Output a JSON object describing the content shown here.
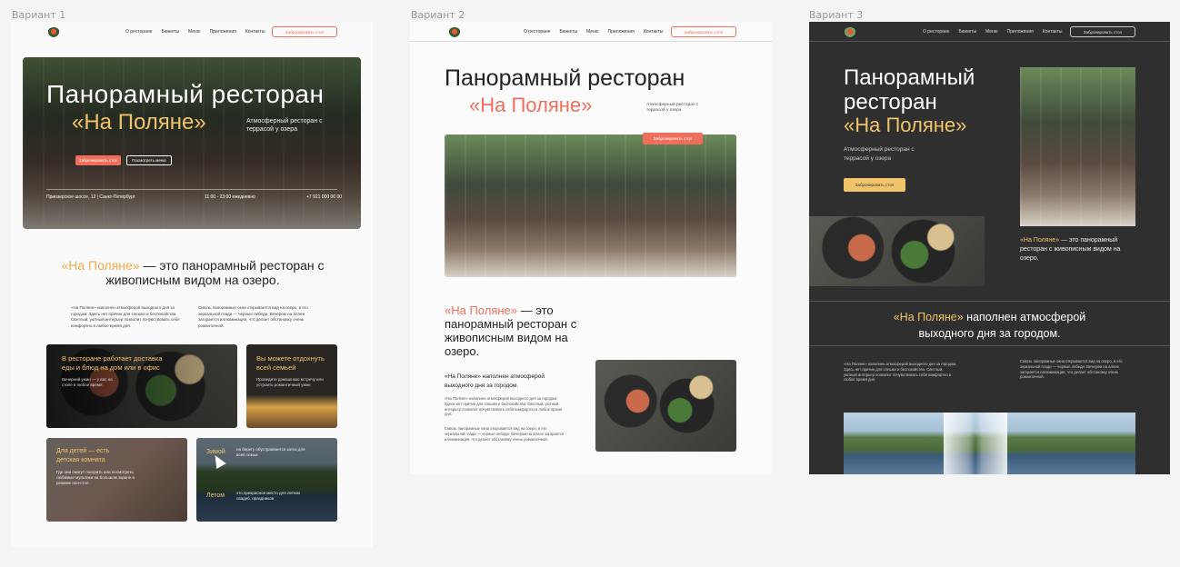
{
  "variants": [
    {
      "label": "Вариант 1"
    },
    {
      "label": "Вариант 2"
    },
    {
      "label": "Вариант 3"
    }
  ],
  "nav": {
    "items": [
      "О ресторане",
      "Банкеты",
      "Меню",
      "Приложения",
      "Контакты"
    ],
    "cta": "Забронировать стол"
  },
  "v1": {
    "hero_title": "Панорамный ресторан",
    "hero_name": "«На Поляне»",
    "hero_sub": "Атмосферный ресторан с террасой у озера",
    "btn_book": "Забронировать стол",
    "btn_menu": "Посмотреть меню",
    "address": "Приозерское шоссе, 12 | Санкт-Петербург",
    "hours": "11:00 - 23:00 ежедневно",
    "phone": "+7 921 000 00 00",
    "lead_name": "«На Поляне»",
    "lead_rest": " — это панорамный ресторан с живописным видом на озеро.",
    "para1": "«На Поляне» наполнен атмосферой выходного дня за городом. Здесь нет причин для спешки и беспокойства. Светлый, уютный интерьер позволит почувствовать себя комфортно в любое время дня.",
    "para2": "Сквозь панорамные окна открывается вид на озеро, в его зеркальной глади — черные лебеди. Вечером на аллее загорается иллюминация, что делает обстановку очень романтичной.",
    "card1_title": "В ресторане работает доставка еды и блюд на дом или в офис",
    "card1_text": "Вечерний ужин — у вас на столе в любое время",
    "card2_title": "Вы можете отдохнуть всей семьей",
    "card2_text": "Проведите домашнюю встречу или устроить романтичный ужин",
    "card3_title": "Для детей — есть детская комната",
    "card3_text": "Где они смогут поиграть или посмотреть любимые мультики на большом экране в режиме нон-стоп",
    "card4_a": "Зимой",
    "card4_a_text": "на берегу обустраивается каток для всей семьи",
    "card4_b": "Летом",
    "card4_b_text": "это прекрасное место для летних свадеб, праздников"
  },
  "v2": {
    "hero_title": "Панорамный ресторан",
    "hero_name": "«На Поляне»",
    "hero_sub": "Атмосферный ресторан с террасой у озера",
    "btn_book": "Забронировать стол",
    "lead_name": "«На Поляне»",
    "lead_rest": " — это панорамный ресторан с живописным видом на озеро.",
    "sub_head": "«На Поляне» наполнен атмосферой выходного дня за городом.",
    "para1": "«На Поляне» наполнен атмосферой выходного дня за городом. Здесь нет причин для спешки и беспокойства. Светлый, уютный интерьер позволит почувствовать себя комфортно в любое время дня.",
    "para2": "Сквозь панорамные окна открывается вид на озеро, в его зеркальной глади — черные лебеди. Вечером на аллее загорается иллюминация, что делает обстановку очень романтичной."
  },
  "v3": {
    "hero_title": "Панорамный ресторан",
    "hero_name": "«На Поляне»",
    "hero_sub": "Атмосферный ресторан с террасой у озера",
    "btn_book": "Забронировать стол",
    "side_name": "«На Поляне»",
    "side_rest": " — это панорамный ресторан с живописным видом на озеро.",
    "band_name": "«На Поляне»",
    "band_rest": " наполнен атмосферой выходного дня за городом.",
    "para1": "«На Поляне» наполнен атмосферой выходного дня за городом. Здесь нет причин для спешки и беспокойства. Светлый, уютный интерьер позволит почувствовать себя комфортно в любое время дня.",
    "para2": "Сквозь панорамные окна открывается вид на озеро, в его зеркальной глади — черные лебеди. Вечером на аллее загорается иллюминация, что делает обстановку очень романтичной."
  },
  "colors": {
    "accent_coral": "#ef6f5c",
    "accent_gold": "#f2c46a",
    "dark_bg": "#2f2f2f"
  }
}
